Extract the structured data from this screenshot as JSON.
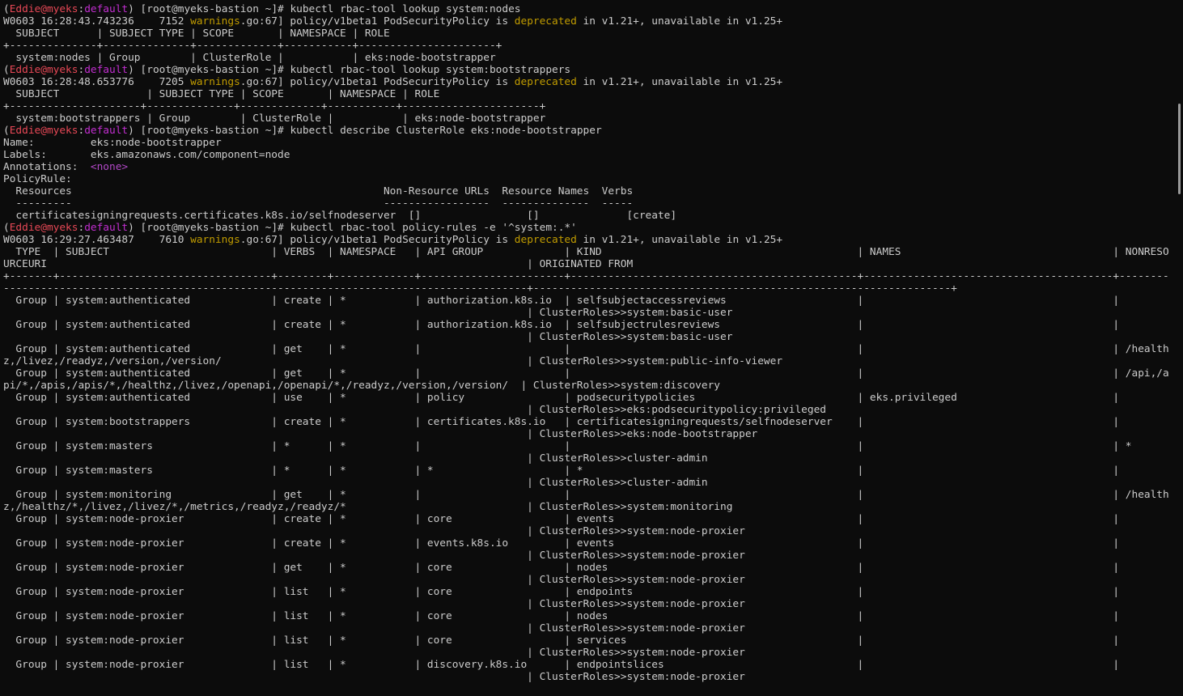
{
  "colors": {
    "background": "#0c0c0c",
    "text": "#cccccc",
    "prompt_user": "#e74856",
    "prompt_host": "#c22ed0",
    "warning_word": "#c19c00",
    "none_tag": "#b148c6"
  },
  "lines": [
    [
      {
        "t": "("
      },
      {
        "t": "Eddie@myeks",
        "c": "red"
      },
      {
        "t": ":"
      },
      {
        "t": "default",
        "c": "magenta"
      },
      {
        "t": ") [root@myeks-bastion ~]# kubectl rbac-tool lookup system:nodes"
      }
    ],
    [
      {
        "t": "W0603 16:28:43.743236    7152 "
      },
      {
        "t": "warnings",
        "c": "yellow"
      },
      {
        "t": ".go:67] policy/v1beta1 PodSecurityPolicy is "
      },
      {
        "t": "deprecated",
        "c": "yellow"
      },
      {
        "t": " in v1.21+, unavailable in v1.25+"
      }
    ],
    [
      {
        "t": "  SUBJECT      | SUBJECT TYPE | SCOPE       | NAMESPACE | ROLE"
      }
    ],
    [
      {
        "t": "+--------------+--------------+-------------+-----------+----------------------+"
      }
    ],
    [
      {
        "t": "  system:nodes | Group        | ClusterRole |           | eks:node-bootstrapper"
      }
    ],
    [
      {
        "t": "("
      },
      {
        "t": "Eddie@myeks",
        "c": "red"
      },
      {
        "t": ":"
      },
      {
        "t": "default",
        "c": "magenta"
      },
      {
        "t": ") [root@myeks-bastion ~]# kubectl rbac-tool lookup system:bootstrappers"
      }
    ],
    [
      {
        "t": "W0603 16:28:48.653776    7205 "
      },
      {
        "t": "warnings",
        "c": "yellow"
      },
      {
        "t": ".go:67] policy/v1beta1 PodSecurityPolicy is "
      },
      {
        "t": "deprecated",
        "c": "yellow"
      },
      {
        "t": " in v1.21+, unavailable in v1.25+"
      }
    ],
    [
      {
        "t": "  SUBJECT              | SUBJECT TYPE | SCOPE       | NAMESPACE | ROLE"
      }
    ],
    [
      {
        "t": "+---------------------+--------------+-------------+-----------+----------------------+"
      }
    ],
    [
      {
        "t": "  system:bootstrappers | Group        | ClusterRole |           | eks:node-bootstrapper"
      }
    ],
    [
      {
        "t": "("
      },
      {
        "t": "Eddie@myeks",
        "c": "red"
      },
      {
        "t": ":"
      },
      {
        "t": "default",
        "c": "magenta"
      },
      {
        "t": ") [root@myeks-bastion ~]# kubectl describe ClusterRole eks:node-bootstrapper"
      }
    ],
    [
      {
        "t": "Name:         eks:node-bootstrapper"
      }
    ],
    [
      {
        "t": "Labels:       eks.amazonaws.com/component=node"
      }
    ],
    [
      {
        "t": "Annotations:  "
      },
      {
        "t": "<none>",
        "c": "none"
      }
    ],
    [
      {
        "t": "PolicyRule:"
      }
    ],
    [
      {
        "t": "  Resources                                                  Non-Resource URLs  Resource Names  Verbs"
      }
    ],
    [
      {
        "t": "  ---------                                                  -----------------  --------------  -----"
      }
    ],
    [
      {
        "t": "  certificatesigningrequests.certificates.k8s.io/selfnodeserver  []                 []              [create]"
      }
    ],
    [
      {
        "t": "("
      },
      {
        "t": "Eddie@myeks",
        "c": "red"
      },
      {
        "t": ":"
      },
      {
        "t": "default",
        "c": "magenta"
      },
      {
        "t": ") [root@myeks-bastion ~]# kubectl rbac-tool policy-rules -e '^system:.*'"
      }
    ],
    [
      {
        "t": "W0603 16:29:27.463487    7610 "
      },
      {
        "t": "warnings",
        "c": "yellow"
      },
      {
        "t": ".go:67] policy/v1beta1 PodSecurityPolicy is "
      },
      {
        "t": "deprecated",
        "c": "yellow"
      },
      {
        "t": " in v1.21+, unavailable in v1.25+"
      }
    ],
    [
      {
        "t": "  TYPE  | SUBJECT                          | VERBS  | NAMESPACE   | API GROUP             | KIND                                         | NAMES                                  | NONRESO"
      }
    ],
    [
      {
        "t": "URCEURI                                                                             | ORIGINATED FROM"
      }
    ],
    [
      {
        "t": "+-------+----------------------------------+--------+-------------+-----------------------+----------------------------------------------+----------------------------------------+--------"
      }
    ],
    [
      {
        "t": "------------------------------------------------------------------------------------+-------------------------------------------------------------------+"
      }
    ],
    [
      {
        "t": "  Group | system:authenticated             | create | *           | authorization.k8s.io  | selfsubjectaccessreviews                     |                                        |"
      }
    ],
    [
      {
        "t": "                                                                                    | ClusterRoles>>system:basic-user"
      }
    ],
    [
      {
        "t": "  Group | system:authenticated             | create | *           | authorization.k8s.io  | selfsubjectrulesreviews                      |                                        |"
      }
    ],
    [
      {
        "t": "                                                                                    | ClusterRoles>>system:basic-user"
      }
    ],
    [
      {
        "t": "  Group | system:authenticated             | get    | *           |                       |                                              |                                        | /health"
      }
    ],
    [
      {
        "t": "z,/livez,/readyz,/version,/version/                                                 | ClusterRoles>>system:public-info-viewer"
      }
    ],
    [
      {
        "t": "  Group | system:authenticated             | get    | *           |                       |                                              |                                        | /api,/a"
      }
    ],
    [
      {
        "t": "pi/*,/apis,/apis/*,/healthz,/livez,/openapi,/openapi/*,/readyz,/version,/version/  | ClusterRoles>>system:discovery"
      }
    ],
    [
      {
        "t": "  Group | system:authenticated             | use    | *           | policy                | podsecuritypolicies                          | eks.privileged                         |"
      }
    ],
    [
      {
        "t": "                                                                                    | ClusterRoles>>eks:podsecuritypolicy:privileged"
      }
    ],
    [
      {
        "t": "  Group | system:bootstrappers             | create | *           | certificates.k8s.io   | certificatesigningrequests/selfnodeserver    |                                        |"
      }
    ],
    [
      {
        "t": "                                                                                    | ClusterRoles>>eks:node-bootstrapper"
      }
    ],
    [
      {
        "t": "  Group | system:masters                   | *      | *           |                       |                                              |                                        | *"
      }
    ],
    [
      {
        "t": "                                                                                    | ClusterRoles>>cluster-admin"
      }
    ],
    [
      {
        "t": "  Group | system:masters                   | *      | *           | *                     | *                                            |                                        |"
      }
    ],
    [
      {
        "t": "                                                                                    | ClusterRoles>>cluster-admin"
      }
    ],
    [
      {
        "t": "  Group | system:monitoring                | get    | *           |                       |                                              |                                        | /health"
      }
    ],
    [
      {
        "t": "z,/healthz/*,/livez,/livez/*,/metrics,/readyz,/readyz/*                             | ClusterRoles>>system:monitoring"
      }
    ],
    [
      {
        "t": "  Group | system:node-proxier              | create | *           | core                  | events                                       |                                        |"
      }
    ],
    [
      {
        "t": "                                                                                    | ClusterRoles>>system:node-proxier"
      }
    ],
    [
      {
        "t": "  Group | system:node-proxier              | create | *           | events.k8s.io         | events                                       |                                        |"
      }
    ],
    [
      {
        "t": "                                                                                    | ClusterRoles>>system:node-proxier"
      }
    ],
    [
      {
        "t": "  Group | system:node-proxier              | get    | *           | core                  | nodes                                        |                                        |"
      }
    ],
    [
      {
        "t": "                                                                                    | ClusterRoles>>system:node-proxier"
      }
    ],
    [
      {
        "t": "  Group | system:node-proxier              | list   | *           | core                  | endpoints                                    |                                        |"
      }
    ],
    [
      {
        "t": "                                                                                    | ClusterRoles>>system:node-proxier"
      }
    ],
    [
      {
        "t": "  Group | system:node-proxier              | list   | *           | core                  | nodes                                        |                                        |"
      }
    ],
    [
      {
        "t": "                                                                                    | ClusterRoles>>system:node-proxier"
      }
    ],
    [
      {
        "t": "  Group | system:node-proxier              | list   | *           | core                  | services                                     |                                        |"
      }
    ],
    [
      {
        "t": "                                                                                    | ClusterRoles>>system:node-proxier"
      }
    ],
    [
      {
        "t": "  Group | system:node-proxier              | list   | *           | discovery.k8s.io      | endpointslices                               |                                        |"
      }
    ],
    [
      {
        "t": "                                                                                    | ClusterRoles>>system:node-proxier"
      }
    ]
  ]
}
